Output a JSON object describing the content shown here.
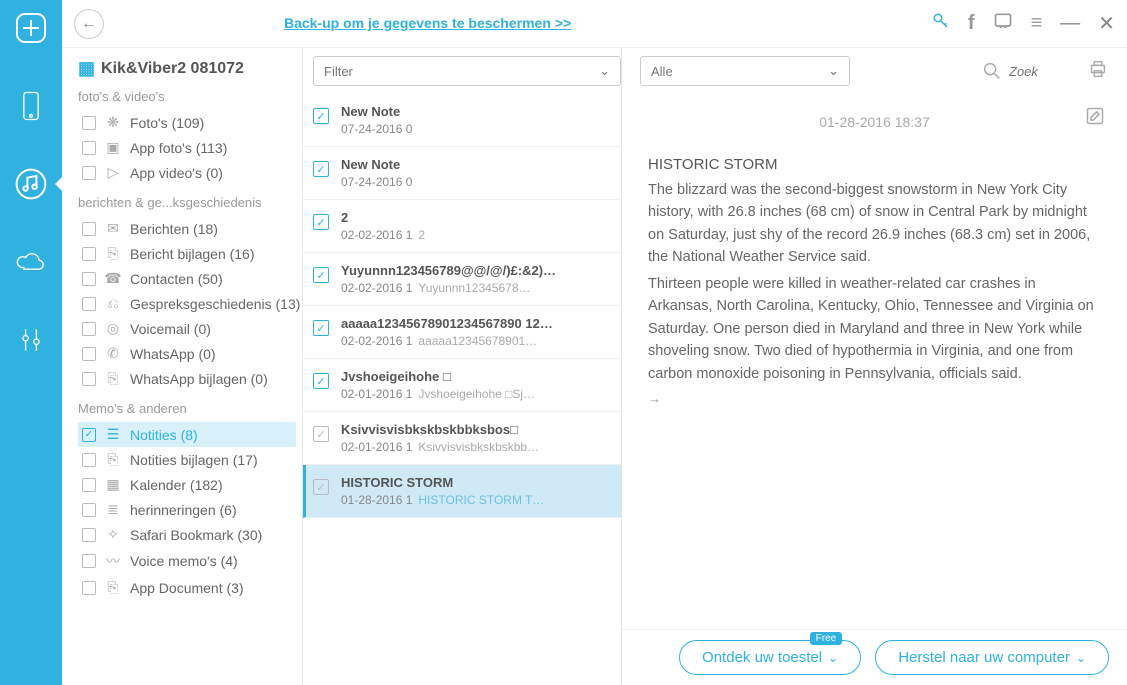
{
  "promo_link": "Back-up om je gegevens te beschermen >>",
  "device_title": "Kik&Viber2 081072",
  "groups": {
    "media": {
      "label": "foto's & video's"
    },
    "msgs": {
      "label": "berichten & ge...ksgeschiedenis"
    },
    "memos": {
      "label": "Memo's & anderen"
    }
  },
  "tree": {
    "photos": "Foto's (109)",
    "app_photos": "App foto's (113)",
    "app_videos": "App video's (0)",
    "berichten": "Berichten (18)",
    "bericht_bijlagen": "Bericht bijlagen (16)",
    "contacten": "Contacten (50)",
    "gesprek": "Gespreksgeschiedenis (13)",
    "voicemail": "Voicemail (0)",
    "whatsapp": "WhatsApp (0)",
    "whatsapp_att": "WhatsApp bijlagen (0)",
    "notities": "Notities (8)",
    "notities_att": "Notities bijlagen (17)",
    "kalender": "Kalender (182)",
    "herinneringen": "herinneringen (6)",
    "safari": "Safari Bookmark (30)",
    "voice_memo": "Voice memo's (4)",
    "app_document": "App Document (3)"
  },
  "filter_label": "Filter",
  "all_label": "Alle",
  "search_placeholder": "Zoek",
  "rows": [
    {
      "title": "New Note",
      "sub": "07-24-2016 0",
      "preview": ""
    },
    {
      "title": "New Note",
      "sub": "07-24-2016 0",
      "preview": ""
    },
    {
      "title": "2",
      "sub": "02-02-2016 1",
      "preview": "2"
    },
    {
      "title": "Yuyunnn123456789@@/@/)£:&2)…",
      "sub": "02-02-2016 1",
      "preview": "Yuyunnn12345678…"
    },
    {
      "title": "aaaaa12345678901234567890 12…",
      "sub": "02-02-2016 1",
      "preview": "aaaaa12345678901…"
    },
    {
      "title": "Jvshoeigeihohe □",
      "sub": "02-01-2016 1",
      "preview": "Jvshoeigeihohe □Sj…"
    },
    {
      "title": "Ksivvisvisbkskbskbbksbos□",
      "sub": "02-01-2016 1",
      "preview": "Ksivvisvisbkskbskbb…"
    },
    {
      "title": "HISTORIC STORM",
      "sub": "01-28-2016 1",
      "preview": "HISTORIC STORM T…"
    }
  ],
  "note": {
    "date": "01-28-2016 18:37",
    "title": "HISTORIC STORM",
    "p1": "The blizzard was the second-biggest snowstorm in New York City history, with 26.8 inches (68 cm) of snow in Central Park by midnight on Saturday, just shy of the record 26.9 inches (68.3 cm) set in 2006, the National Weather Service said.",
    "p2": "Thirteen people were killed in weather-related car crashes in Arkansas, North Carolina, Kentucky, Ohio, Tennessee and Virginia on Saturday. One person died in Maryland and three in New York while shoveling snow. Two died of hypothermia in Virginia, and one from carbon monoxide poisoning in Pennsylvania, officials said."
  },
  "cta": {
    "discover": "Ontdek uw toestel",
    "discover_badge": "Free",
    "restore": "Herstel naar uw computer"
  }
}
